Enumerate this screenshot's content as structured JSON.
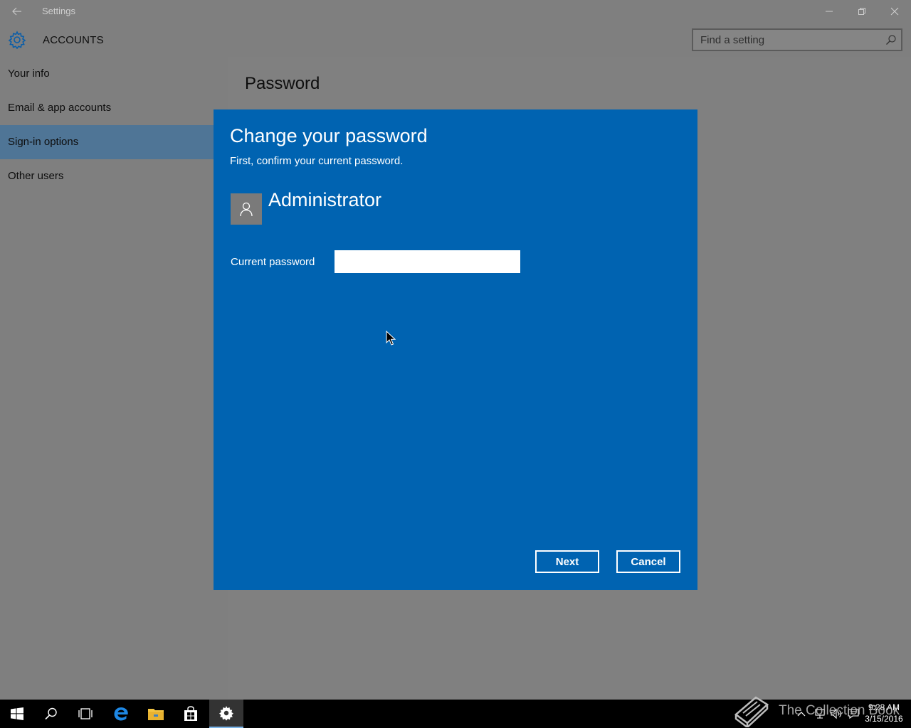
{
  "window": {
    "title": "Settings",
    "controls": [
      "minimize-icon",
      "restore-icon",
      "close-icon"
    ]
  },
  "header": {
    "section": "ACCOUNTS",
    "search_placeholder": "Find a setting"
  },
  "sidebar": {
    "items": [
      {
        "label": "Your info",
        "selected": false
      },
      {
        "label": "Email & app accounts",
        "selected": false
      },
      {
        "label": "Sign-in options",
        "selected": true
      },
      {
        "label": "Other users",
        "selected": false
      }
    ]
  },
  "content": {
    "heading": "Password"
  },
  "dialog": {
    "title": "Change your password",
    "subtitle": "First, confirm your current password.",
    "username": "Administrator",
    "password_label": "Current password",
    "password_value": "",
    "next_label": "Next",
    "cancel_label": "Cancel"
  },
  "taskbar": {
    "apps": [
      "start-icon",
      "search-icon",
      "task-view-icon",
      "edge-icon",
      "file-explorer-icon",
      "store-icon",
      "settings-icon"
    ],
    "active_app": "settings-icon",
    "time": "9:28 AM",
    "date": "3/15/2016"
  },
  "watermark": {
    "text": "The Collection Book"
  },
  "colors": {
    "dialog_bg": "#0063b1",
    "selected_nav": "#4f7596",
    "accent": "#0078d7"
  }
}
